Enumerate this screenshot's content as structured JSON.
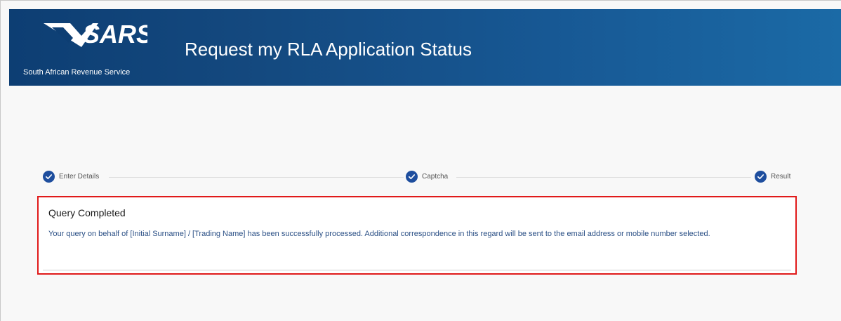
{
  "header": {
    "logo_text": "SARS",
    "logo_subtitle": "South African Revenue Service",
    "title": "Request my RLA Application Status"
  },
  "steps": [
    {
      "label": "Enter Details",
      "icon": "check-icon"
    },
    {
      "label": "Captcha",
      "icon": "check-icon"
    },
    {
      "label": "Result",
      "icon": "check-icon"
    }
  ],
  "result": {
    "title": "Query Completed",
    "message": "Your query on behalf of [Initial Surname] / [Trading Name] has been successfully processed.  Additional correspondence in this regard will be sent to the email address or mobile number selected."
  },
  "colors": {
    "header_dark": "#0d3e73",
    "header_light": "#1b6aa6",
    "step_check": "#1e4e9e",
    "highlight_border": "#e01a1a",
    "message_text": "#2a4f85"
  }
}
